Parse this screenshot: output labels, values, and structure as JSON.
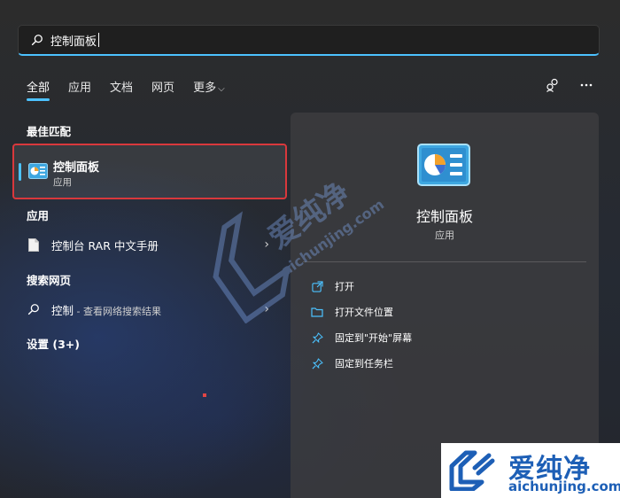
{
  "search": {
    "query": "控制面板"
  },
  "tabs": [
    {
      "label": "全部",
      "active": true
    },
    {
      "label": "应用",
      "active": false
    },
    {
      "label": "文档",
      "active": false
    },
    {
      "label": "网页",
      "active": false
    },
    {
      "label": "更多",
      "active": false
    }
  ],
  "top_icons": [
    "account-switch-icon",
    "more-options-icon"
  ],
  "sections": {
    "best_match": "最佳匹配",
    "apps": "应用",
    "web": "搜索网页",
    "settings": "设置 (3+)"
  },
  "best_match": {
    "name": "控制面板",
    "type": "应用"
  },
  "apps": [
    {
      "name": "控制台 RAR 中文手册",
      "icon": "document-icon"
    }
  ],
  "web": [
    {
      "name": "控制",
      "hint": " - 查看网络搜索结果",
      "icon": "search-icon"
    }
  ],
  "panel": {
    "name": "控制面板",
    "type": "应用",
    "actions": [
      {
        "label": "打开",
        "icon": "open-icon"
      },
      {
        "label": "打开文件位置",
        "icon": "folder-icon"
      },
      {
        "label": "固定到\"开始\"屏幕",
        "icon": "pin-icon"
      },
      {
        "label": "固定到任务栏",
        "icon": "pin-icon"
      }
    ]
  },
  "watermark": {
    "cn": "爱纯净",
    "en": "aichunjing.com"
  },
  "colors": {
    "accent": "#4cc2ff",
    "highlight_border": "#d9383c",
    "watermark_blue": "#1d5fb6"
  }
}
